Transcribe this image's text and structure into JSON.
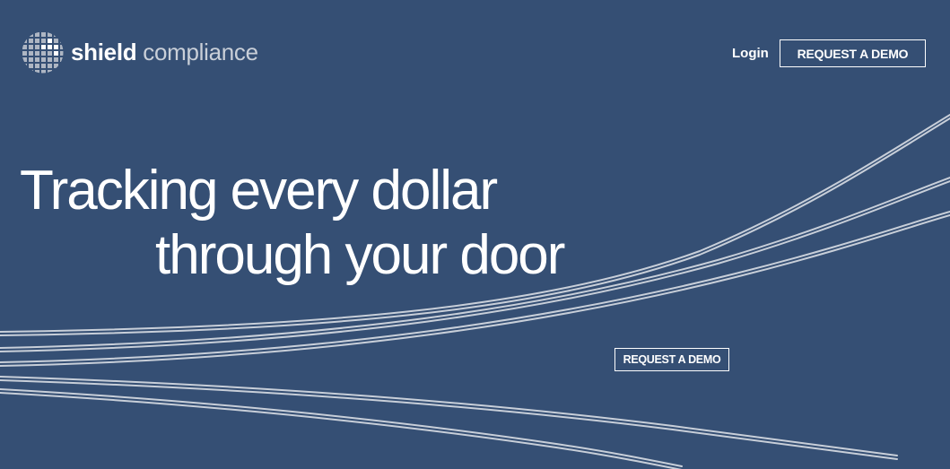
{
  "brand": {
    "name_bold": "shield",
    "name_light": "compliance",
    "logo_icon": "grid-globe-icon"
  },
  "nav": {
    "login_label": "Login",
    "demo_button_label": "REQUEST A DEMO"
  },
  "hero": {
    "headline_line1": "Tracking every dollar",
    "headline_line2": "through your door",
    "cta_label": "REQUEST A DEMO",
    "decoration": "flowing-lines"
  },
  "colors": {
    "background": "#354f74",
    "text": "#ffffff",
    "logo_secondary": "#c9cfd8"
  }
}
